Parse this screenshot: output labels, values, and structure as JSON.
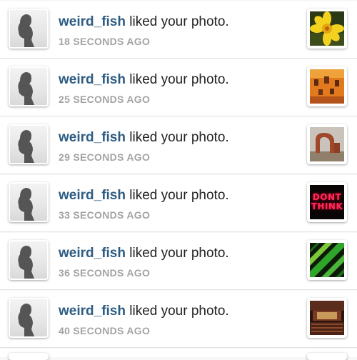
{
  "notifications": [
    {
      "username": "weird_fish",
      "action": " liked your photo.",
      "time": "18 SECONDS AGO",
      "thumb": "daffodil-thumbnail"
    },
    {
      "username": "weird_fish",
      "action": " liked your photo.",
      "time": "25 SECONDS AGO",
      "thumb": "orange-wall-thumbnail"
    },
    {
      "username": "weird_fish",
      "action": " liked your photo.",
      "time": "29 SECONDS AGO",
      "thumb": "rock-arch-thumbnail"
    },
    {
      "username": "weird_fish",
      "action": " liked your photo.",
      "time": "33 SECONDS AGO",
      "thumb": "neon-sign-thumbnail",
      "thumb_text": [
        "DONT",
        "THINK"
      ]
    },
    {
      "username": "weird_fish",
      "action": " liked your photo.",
      "time": "36 SECONDS AGO",
      "thumb": "green-stripes-thumbnail"
    },
    {
      "username": "weird_fish",
      "action": " liked your photo.",
      "time": "40 SECONDS AGO",
      "thumb": "concert-hall-thumbnail"
    }
  ],
  "colors": {
    "username": "#2d5c83",
    "timestamp": "#a3a3a3",
    "text": "#222222"
  }
}
